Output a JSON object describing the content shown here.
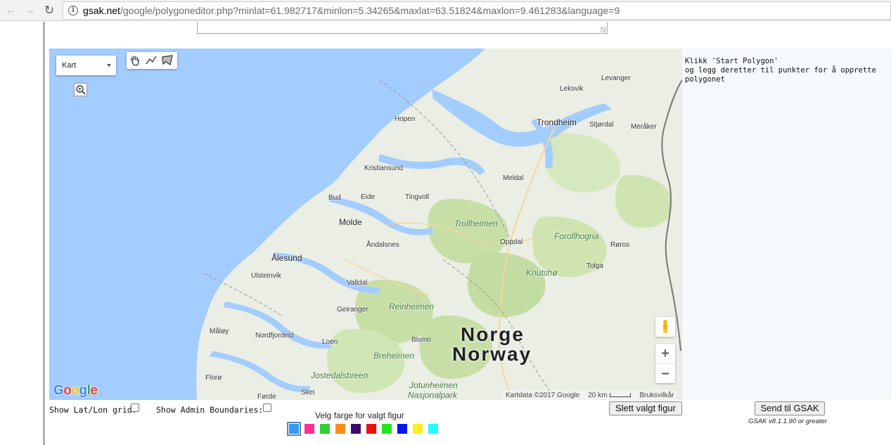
{
  "browser": {
    "back_icon": "arrow-left-icon",
    "forward_icon": "arrow-right-icon",
    "reload_icon": "reload-icon",
    "url_host": "gsak.net",
    "url_rest": "/google/polygoneditor.php?minlat=61.982717&minlon=5.34265&maxlat=63.51824&maxlon=9.461283&language=9"
  },
  "map": {
    "map_type_label": "Kart",
    "tools": [
      "hand-pan-icon",
      "polyline-icon",
      "polygon-icon"
    ],
    "country_line1": "Norge",
    "country_line2": "Norway",
    "labels": {
      "leksvik": "Leksvik",
      "levanger": "Levanger",
      "hopen": "Hopen",
      "trondheim": "Trondheim",
      "stjordal": "Stjørdal",
      "meraker": "Meråker",
      "kristiansund": "Kristiansund",
      "meldal": "Meldal",
      "bud": "Bud",
      "eide": "Eide",
      "tingvoll": "Tingvoll",
      "molde": "Molde",
      "trollheimen": "Trollheimen",
      "andalsnes": "Åndalsnes",
      "oppdal": "Oppdal",
      "forollhogna": "Forollhogna",
      "roros": "Røros",
      "alesund": "Ålesund",
      "ulsteinvik": "Ulsteinvik",
      "knutsho": "Knutshø",
      "tolga": "Tolga",
      "valldal": "Valldal",
      "reinheimen": "Reinheimen",
      "geiranger": "Geiranger",
      "maloy": "Måløy",
      "nordfjordeid": "Nordfjordeid",
      "loen": "Loen",
      "bismo": "Bismo",
      "breheimen": "Breheimen",
      "jostedalsbreen": "Jostedalsbreen",
      "floro": "Florø",
      "skei": "Skei",
      "jotunheimen_1": "Jotunheimen",
      "jotunheimen_2": "Nasjonalpark",
      "forde": "Førde"
    },
    "attribution": "Kartdata ©2017 Google",
    "scale": "20 km",
    "terms": "Bruksvilkår",
    "zoom_in": "+",
    "zoom_out": "−"
  },
  "info_panel": {
    "lines": [
      "Klikk 'Start Polygon'",
      "og legg deretter til punkter for å opprette",
      "polygonet"
    ]
  },
  "controls": {
    "latlon_label": "Show Lat/Lon grid:",
    "admin_label": "Show Admin Boundaries:",
    "delete_button": "Slett valgt figur",
    "send_button": "Send til GSAK",
    "version": "GSAK v8.1.1.90 or greater",
    "color_heading": "Velg farge for valgt figur",
    "colors": [
      "#3399ff",
      "#ff2f92",
      "#33cc33",
      "#ff8c1a",
      "#3d0a73",
      "#ee1111",
      "#22e622",
      "#0a17f0",
      "#ffee22",
      "#22ffff"
    ],
    "selected_color_index": 0
  }
}
